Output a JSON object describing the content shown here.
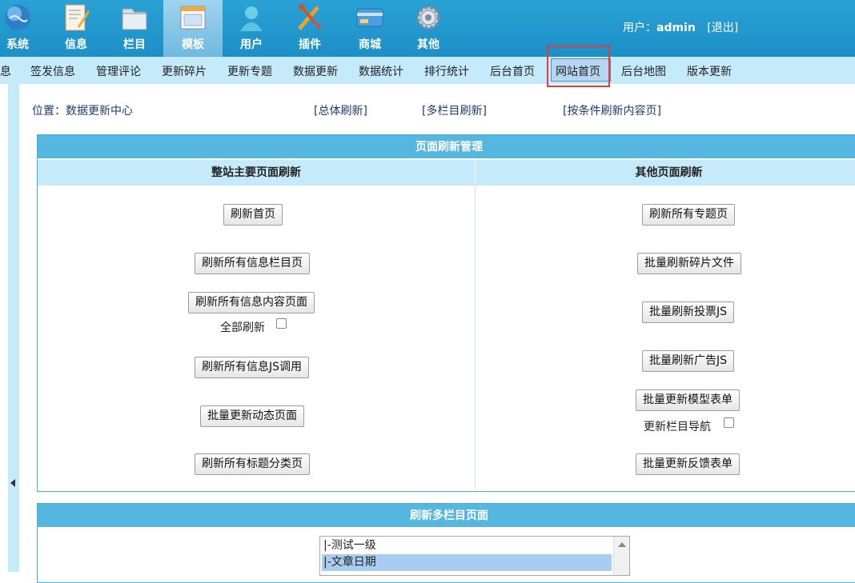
{
  "topnav": {
    "items": [
      {
        "label": "系统",
        "icon": "globe-icon"
      },
      {
        "label": "信息",
        "icon": "document-edit-icon"
      },
      {
        "label": "栏目",
        "icon": "folder-icon"
      },
      {
        "label": "模板",
        "icon": "window-template-icon"
      },
      {
        "label": "用户",
        "icon": "user-icon"
      },
      {
        "label": "插件",
        "icon": "tools-icon"
      },
      {
        "label": "商城",
        "icon": "credit-card-icon"
      },
      {
        "label": "其他",
        "icon": "gear-icon"
      }
    ],
    "active_index": 3
  },
  "user": {
    "prefix": "用户：",
    "name": "admin",
    "logout": "[退出]"
  },
  "subnav": {
    "items": [
      "息",
      "签发信息",
      "管理评论",
      "更新碎片",
      "更新专题",
      "数据更新",
      "数据统计",
      "排行统计",
      "后台首页",
      "网站首页",
      "后台地图",
      "版本更新"
    ],
    "highlighted": "网站首页"
  },
  "location": {
    "label": "位置：",
    "current": "数据更新中心",
    "links": [
      "[总体刷新]",
      "[多栏目刷新]",
      "[按条件刷新内容页]"
    ]
  },
  "refresh_panel": {
    "title": "页面刷新管理",
    "left_header": "整站主要页面刷新",
    "right_header": "其他页面刷新",
    "left_buttons": [
      "刷新首页",
      "刷新所有信息栏目页",
      "刷新所有信息内容页面",
      "刷新所有信息JS调用",
      "批量更新动态页面",
      "刷新所有标题分类页"
    ],
    "left_checkbox": {
      "label": "全部刷新",
      "checked": false
    },
    "right_buttons": [
      "刷新所有专题页",
      "批量刷新碎片文件",
      "批量刷新投票JS",
      "批量刷新广告JS",
      "批量更新模型表单",
      "批量更新反馈表单"
    ],
    "right_checkbox": {
      "label": "更新栏目导航",
      "checked": false
    }
  },
  "multi_panel": {
    "title": "刷新多栏目页面",
    "options": [
      "|-测试一级",
      "|-文章日期"
    ],
    "selected": "|-文章日期"
  },
  "colors": {
    "header_blue": "#2aa2d6",
    "subnav_bg": "#c5ebfa",
    "panel_title": "#55b6df",
    "highlight_red": "#e23b3b"
  }
}
